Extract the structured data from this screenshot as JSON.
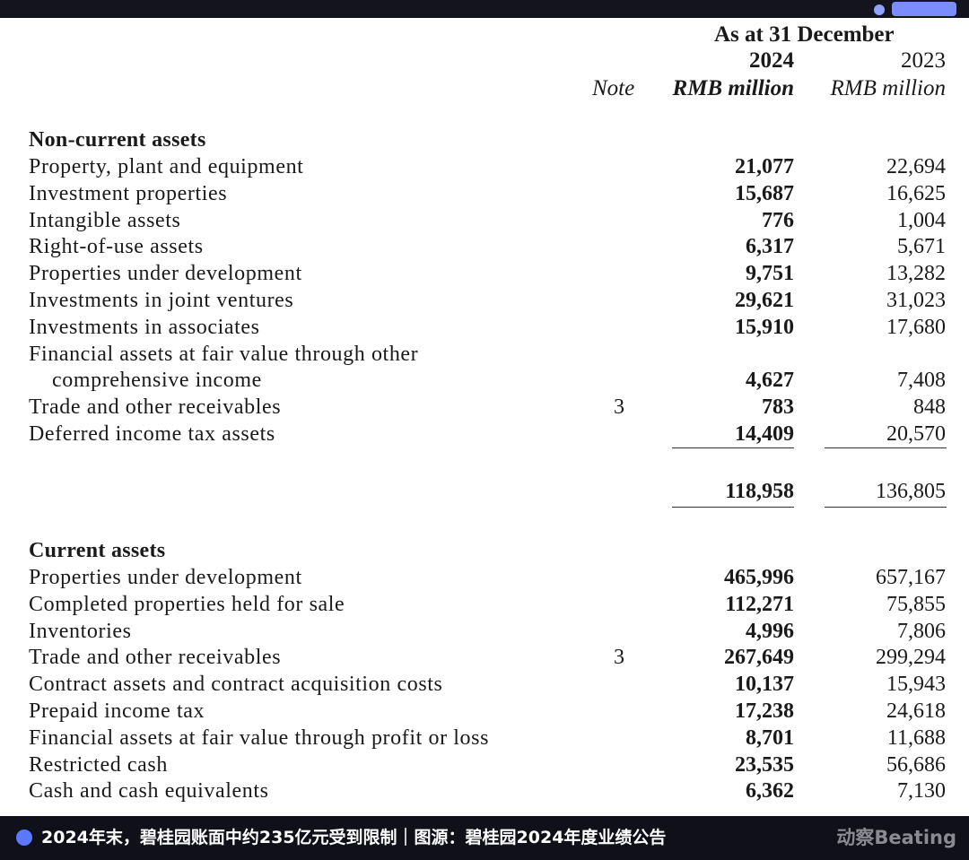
{
  "header": {
    "period": "As at 31 December",
    "year_current": "2024",
    "year_prior": "2023",
    "note_label": "Note",
    "unit_current": "RMB million",
    "unit_prior": "RMB million"
  },
  "non_current": {
    "title": "Non-current assets",
    "rows": [
      {
        "label": "Property, plant and equipment",
        "note": "",
        "v2024": "21,077",
        "v2023": "22,694"
      },
      {
        "label": "Investment properties",
        "note": "",
        "v2024": "15,687",
        "v2023": "16,625"
      },
      {
        "label": "Intangible assets",
        "note": "",
        "v2024": "776",
        "v2023": "1,004"
      },
      {
        "label": "Right-of-use assets",
        "note": "",
        "v2024": "6,317",
        "v2023": "5,671"
      },
      {
        "label": "Properties under development",
        "note": "",
        "v2024": "9,751",
        "v2023": "13,282"
      },
      {
        "label": "Investments in joint ventures",
        "note": "",
        "v2024": "29,621",
        "v2023": "31,023"
      },
      {
        "label": "Investments in associates",
        "note": "",
        "v2024": "15,910",
        "v2023": "17,680"
      },
      {
        "label": "Financial assets at fair value through other",
        "note": "",
        "v2024": "",
        "v2023": ""
      },
      {
        "label": "comprehensive income",
        "note": "",
        "v2024": "4,627",
        "v2023": "7,408",
        "indent": true
      },
      {
        "label": "Trade and other receivables",
        "note": "3",
        "v2024": "783",
        "v2023": "848"
      },
      {
        "label": "Deferred income tax assets",
        "note": "",
        "v2024": "14,409",
        "v2023": "20,570"
      }
    ],
    "total_2024": "118,958",
    "total_2023": "136,805"
  },
  "current": {
    "title": "Current assets",
    "rows": [
      {
        "label": "Properties under development",
        "note": "",
        "v2024": "465,996",
        "v2023": "657,167"
      },
      {
        "label": "Completed properties held for sale",
        "note": "",
        "v2024": "112,271",
        "v2023": "75,855"
      },
      {
        "label": "Inventories",
        "note": "",
        "v2024": "4,996",
        "v2023": "7,806"
      },
      {
        "label": "Trade and other receivables",
        "note": "3",
        "v2024": "267,649",
        "v2023": "299,294"
      },
      {
        "label": "Contract assets and contract acquisition costs",
        "note": "",
        "v2024": "10,137",
        "v2023": "15,943"
      },
      {
        "label": "Prepaid income tax",
        "note": "",
        "v2024": "17,238",
        "v2023": "24,618"
      },
      {
        "label": "Financial assets at fair value through profit or loss",
        "note": "",
        "v2024": "8,701",
        "v2023": "11,688"
      },
      {
        "label": "Restricted cash",
        "note": "",
        "v2024": "23,535",
        "v2023": "56,686"
      },
      {
        "label": "Cash and cash equivalents",
        "note": "",
        "v2024": "6,362",
        "v2023": "7,130"
      }
    ]
  },
  "footer": {
    "caption": "2024年末，碧桂园账面中约235亿元受到限制｜图源：碧桂园2024年度业绩公告",
    "brand": "动察Beating"
  }
}
